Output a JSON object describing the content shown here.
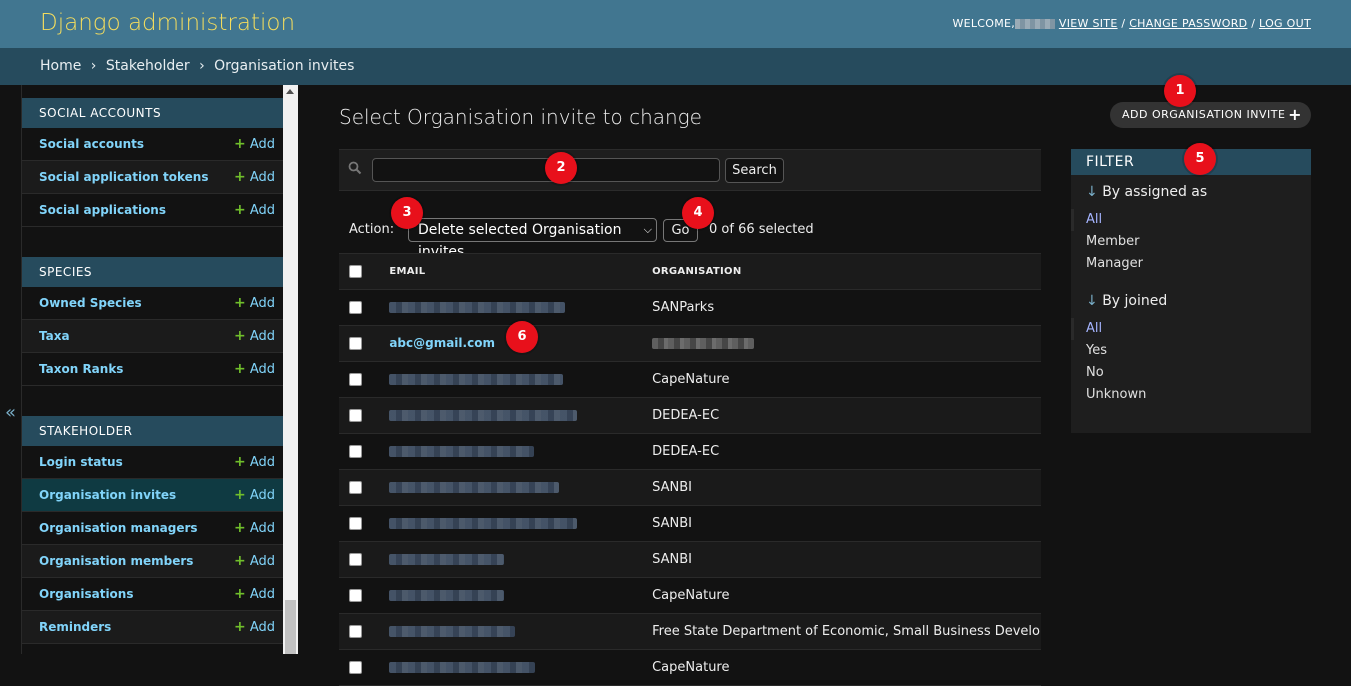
{
  "header": {
    "title": "Django administration",
    "welcome": "WELCOME,",
    "view_site": "VIEW SITE",
    "change_password": "CHANGE PASSWORD",
    "log_out": "LOG OUT",
    "sep": "/"
  },
  "breadcrumbs": {
    "home": "Home",
    "app": "Stakeholder",
    "current": "Organisation invites",
    "sep": "›"
  },
  "sidebar": {
    "toggle_glyph": "«",
    "add_label": "Add",
    "apps": [
      {
        "caption": "SOCIAL ACCOUNTS",
        "models": [
          "Social accounts",
          "Social application tokens",
          "Social applications"
        ]
      },
      {
        "caption": "SPECIES",
        "models": [
          "Owned Species",
          "Taxa",
          "Taxon Ranks"
        ]
      },
      {
        "caption": "STAKEHOLDER",
        "models": [
          "Login status",
          "Organisation invites",
          "Organisation managers",
          "Organisation members",
          "Organisations",
          "Reminders"
        ]
      }
    ]
  },
  "content": {
    "title": "Select Organisation invite to change",
    "add_button": "ADD ORGANISATION INVITE",
    "search_button": "Search",
    "search_value": "",
    "action_label": "Action:",
    "action_selected": "Delete selected Organisation invites",
    "go_button": "Go",
    "selected_count": "0 of 66 selected",
    "columns": [
      "EMAIL",
      "ORGANISATION"
    ],
    "rows": [
      {
        "email": "",
        "organisation": "SANParks"
      },
      {
        "email": "abc@gmail.com",
        "organisation": ""
      },
      {
        "email": "",
        "organisation": "CapeNature"
      },
      {
        "email": "",
        "organisation": "DEDEA-EC"
      },
      {
        "email": "",
        "organisation": "DEDEA-EC"
      },
      {
        "email": "",
        "organisation": "SANBI"
      },
      {
        "email": "",
        "organisation": "SANBI"
      },
      {
        "email": "",
        "organisation": "SANBI"
      },
      {
        "email": "",
        "organisation": "CapeNature"
      },
      {
        "email": "",
        "organisation": "Free State Department of Economic, Small Business Develo"
      },
      {
        "email": "",
        "organisation": "CapeNature"
      }
    ]
  },
  "filter": {
    "caption": "FILTER",
    "groups": [
      {
        "title": "By assigned as",
        "options": [
          "All",
          "Member",
          "Manager"
        ]
      },
      {
        "title": "By joined",
        "options": [
          "All",
          "Yes",
          "No",
          "Unknown"
        ]
      }
    ]
  },
  "markers": [
    "1",
    "2",
    "3",
    "4",
    "5",
    "6"
  ],
  "colors": {
    "header_bg": "#417690",
    "brand_yellow": "#f5dd5d",
    "breadcrumb_bg": "#264b5d",
    "link_blue": "#81d4fa",
    "add_green": "#70bf2b",
    "marker_red": "#e8101b"
  }
}
